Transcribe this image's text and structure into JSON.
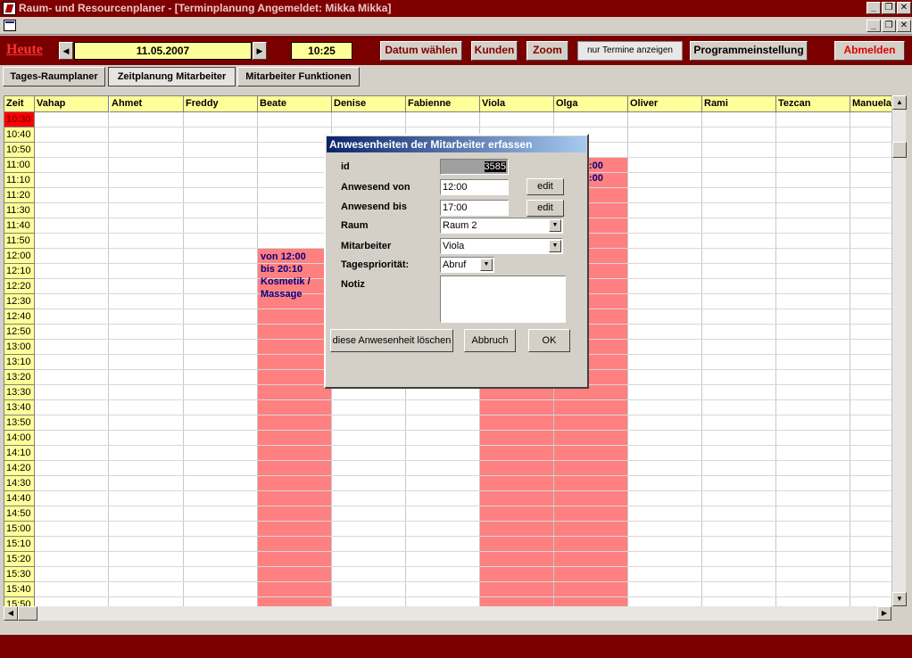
{
  "window": {
    "title": "Raum- und Resourcenplaner - [Terminplanung Angemeldet: Mikka Mikka]"
  },
  "toolbar": {
    "heute_label": "Heute",
    "date": "11.05.2007",
    "time": "10:25",
    "datum_waehlen": "Datum wählen",
    "kunden": "Kunden",
    "zoom": "Zoom",
    "nur_termine": "nur Termine anzeigen",
    "programmeinstellung": "Programmeinstellung",
    "abmelden": "Abmelden"
  },
  "tabs": [
    "Tages-Raumplaner",
    "Zeitplanung Mitarbeiter",
    "Mitarbeiter Funktionen"
  ],
  "grid": {
    "time_header": "Zeit",
    "columns": [
      "Vahap",
      "Ahmet",
      "Freddy",
      "Beate",
      "Denise",
      "Fabienne",
      "Viola",
      "Olga",
      "Oliver",
      "Rami",
      "Tezcan",
      "Manuela"
    ],
    "times": [
      "10:30",
      "10:40",
      "10:50",
      "11:00",
      "11:10",
      "11:20",
      "11:30",
      "11:40",
      "11:50",
      "12:00",
      "12:10",
      "12:20",
      "12:30",
      "12:40",
      "12:50",
      "13:00",
      "13:10",
      "13:20",
      "13:30",
      "13:40",
      "13:50",
      "14:00",
      "14:10",
      "14:20",
      "14:30",
      "14:40",
      "14:50",
      "15:00",
      "15:10",
      "15:20",
      "15:30",
      "15:40",
      "15:50"
    ],
    "current_time": "10:30",
    "beate_appt": {
      "line1": "von 12:00",
      "line2": "bis 20:10",
      "line3": "Kosmetik /",
      "line4": "Massage"
    },
    "olga_appt": {
      "line1": ":00",
      "line2": ":00"
    },
    "appt_color": "#ff8080"
  },
  "dialog": {
    "title": "Anwesenheiten der Mitarbeiter erfassen",
    "id_label": "id",
    "id_value": "3585",
    "von_label": "Anwesend  von",
    "von_value": "12:00",
    "bis_label": "Anwesend bis",
    "bis_value": "17:00",
    "edit": "edit",
    "raum_label": "Raum",
    "raum_value": "Raum 2",
    "mitarbeiter_label": "Mitarbeiter",
    "mitarbeiter_value": "Viola",
    "prio_label": "Tagespriorität:",
    "prio_value": "Abruf",
    "notiz_label": "Notiz",
    "notiz_value": "",
    "loeschen": "diese Anwesenheit löschen",
    "abbruch": "Abbruch",
    "ok": "OK"
  },
  "colors": {
    "frame": "#7a0000",
    "header_yellow": "#ffff99",
    "current_time": "#ff0000"
  }
}
